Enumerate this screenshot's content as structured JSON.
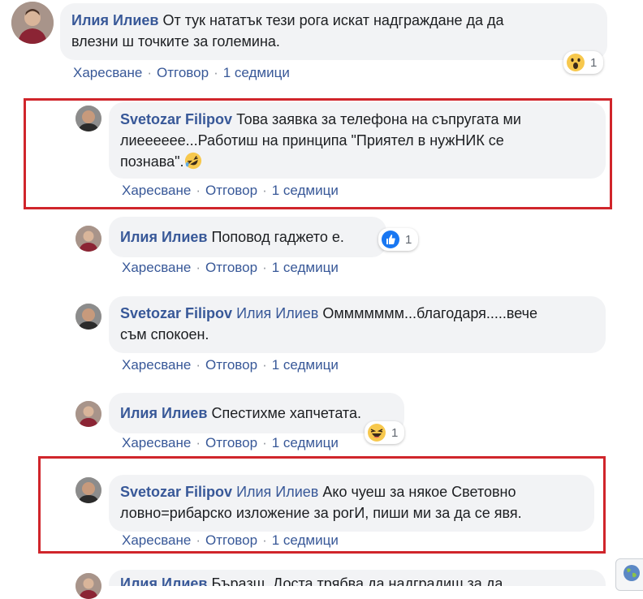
{
  "comments": [
    {
      "author": "Илия Илиев",
      "text_1": "От тук нататък тези рога искат надграждане да да",
      "text_2": "влезни ш точките за големина.",
      "like": "Харесване",
      "reply": "Отговор",
      "time": "1 седмици",
      "reaction": {
        "icon": "wow-emoji-icon",
        "count": "1"
      }
    },
    {
      "author": "Svetozar Filipov",
      "text_1": "Това заявка за телефона на съпругата ми",
      "text_2": "лиеееeee...Работиш на принципа \"Приятел в нужНИК се",
      "text_3": "познава\".",
      "inline_icon": "rolling-laughing-emoji-icon",
      "like": "Харесване",
      "reply": "Отговор",
      "time": "1 седмици"
    },
    {
      "author": "Илия Илиев",
      "text_1": "Поповод гаджето е.",
      "like": "Харесване",
      "reply": "Отговор",
      "time": "1 седмици",
      "reaction": {
        "icon": "thumbs-up-icon",
        "count": "1"
      }
    },
    {
      "author": "Svetozar Filipov",
      "mention": "Илия Илиев",
      "text_1": "Оммммммм...благодаря.....вече",
      "text_2": "съм спокоен.",
      "like": "Харесване",
      "reply": "Отговор",
      "time": "1 седмици"
    },
    {
      "author": "Илия Илиев",
      "text_1": "Спестихме хапчетата.",
      "like": "Харесване",
      "reply": "Отговор",
      "time": "1 седмици",
      "reaction": {
        "icon": "laughing-emoji-icon",
        "count": "1"
      }
    },
    {
      "author": "Svetozar Filipov",
      "mention": "Илия Илиев",
      "text_1": "Ако чуеш за някое Световно",
      "text_2": "ловно=рибарско изложение за рогИ, пиши ми за да се явя.",
      "like": "Харесване",
      "reply": "Отговор",
      "time": "1 седмици"
    },
    {
      "author": "Илия Илиев",
      "text_1": "Бъразш. Доста трябва да надградиш за да"
    }
  ],
  "colors": {
    "link": "#385898",
    "bubble": "#f2f3f5",
    "highlight_box": "#d0252b"
  }
}
